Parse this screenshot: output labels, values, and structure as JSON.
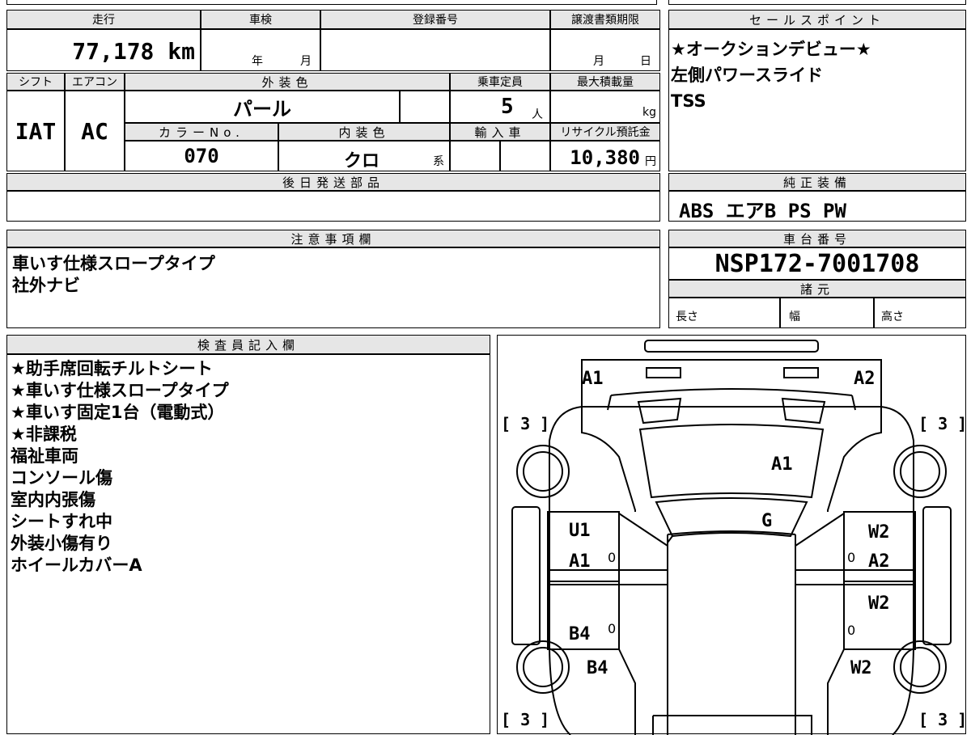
{
  "sheet": {
    "headers": {
      "mileage": "走行",
      "inspection": "車検",
      "registration": "登録番号",
      "transfer_deadline": "譲渡書類期限",
      "sales_points": "セールスポイント",
      "shift": "シフト",
      "aircon": "エアコン",
      "exterior_color": "外装色",
      "capacity": "乗車定員",
      "max_load": "最大積載量",
      "color_no": "カラーNo.",
      "interior_color": "内装色",
      "import": "輸入車",
      "recycle": "リサイクル預託金",
      "later_parts": "後日発送部品",
      "genuine_equipment": "純正装備",
      "notes": "注意事項欄",
      "chassis_no": "車台番号",
      "specs": "諸元",
      "inspector": "検査員記入欄"
    },
    "values": {
      "mileage": "77,178",
      "mileage_unit": "km",
      "inspection_year": "年",
      "inspection_month": "月",
      "deadline_month": "月",
      "deadline_day": "日",
      "shift": "IAT",
      "aircon": "AC",
      "exterior_color": "パール",
      "capacity": "5",
      "capacity_unit": "人",
      "load_unit": "kg",
      "color_no": "070",
      "interior_color": "クロ",
      "interior_suffix": "系",
      "recycle": "10,380",
      "recycle_unit": "円",
      "chassis_no": "NSP172-7001708",
      "length": "長さ",
      "width": "幅",
      "height": "高さ"
    },
    "sales_points": [
      "★オークションデビュー★",
      "左側パワースライド",
      "TSS"
    ],
    "genuine_equipment": "ABS エアB PS PW",
    "notes": [
      "車いす仕様スロープタイプ",
      "社外ナビ"
    ],
    "inspector_notes": [
      "★助手席回転チルトシート",
      "★車いす仕様スロープタイプ",
      "★車いす固定1台（電動式）",
      "★非課税",
      "福祉車両",
      "コンソール傷",
      "室内内張傷",
      "シートすれ中",
      "外装小傷有り",
      "ホイールカバーA"
    ],
    "diagram": {
      "labels": {
        "front_left": "A1",
        "front_right": "A2",
        "hood": "A1",
        "windshield": "G",
        "left_front_door": "U1",
        "left_front_door2": "A1",
        "right_front_door": "W2",
        "right_front_door2": "A2",
        "right_rear_door": "W2",
        "left_rear_door": "B4",
        "left_rear_panel": "B4",
        "right_rear_panel": "W2",
        "tire_fl": "[ 3 ]",
        "tire_fr": "[ 3 ]",
        "tire_rl": "[ 3 ]",
        "tire_rr": "[ 3 ]",
        "zero": "0"
      }
    }
  }
}
